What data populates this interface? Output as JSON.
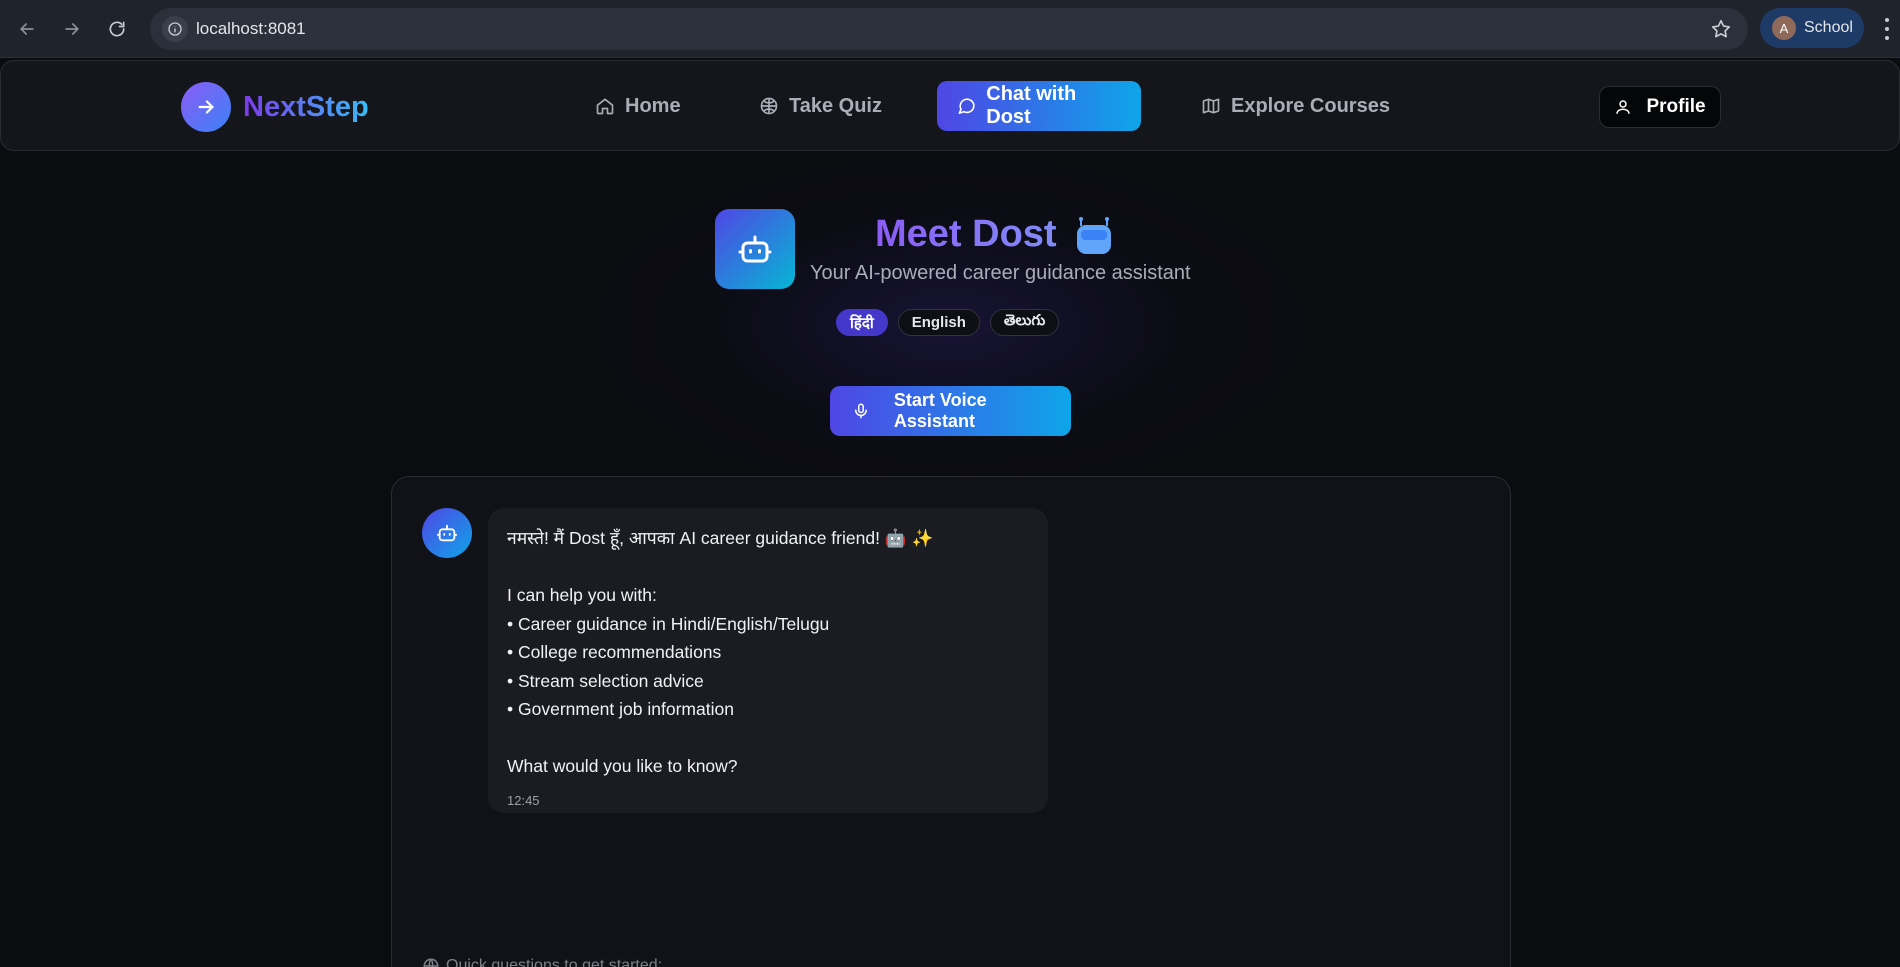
{
  "browser": {
    "url": "localhost:8081",
    "profile_initial": "A",
    "profile_name": "School"
  },
  "navbar": {
    "brand": "NextStep",
    "items": [
      {
        "label": "Home",
        "icon": "home-icon"
      },
      {
        "label": "Take Quiz",
        "icon": "brain-icon"
      },
      {
        "label": "Chat with Dost",
        "icon": "message-circle-icon",
        "active": true
      },
      {
        "label": "Explore Courses",
        "icon": "map-icon"
      }
    ],
    "profile_label": "Profile"
  },
  "hero": {
    "title": "Meet Dost",
    "subtitle": "Your AI-powered career guidance assistant",
    "languages": [
      {
        "label": "हिंदी",
        "active": true
      },
      {
        "label": "English",
        "active": false
      },
      {
        "label": "తెలుగు",
        "active": false
      }
    ],
    "voice_button": "Start Voice Assistant"
  },
  "chat": {
    "messages": [
      {
        "sender": "bot",
        "lines": [
          "नमस्ते! मैं Dost हूँ, आपका AI career guidance friend! 🤖 ✨",
          "",
          "I can help you with:",
          "• Career guidance in Hindi/English/Telugu",
          "• College recommendations",
          "• Stream selection advice",
          "• Government job information",
          "",
          "What would you like to know?"
        ],
        "time": "12:45"
      }
    ],
    "quick_questions_label": "Quick questions to get started:"
  },
  "colors": {
    "accent_start": "#4f46e5",
    "accent_end": "#0ea5e9",
    "background": "#0b0c10"
  }
}
